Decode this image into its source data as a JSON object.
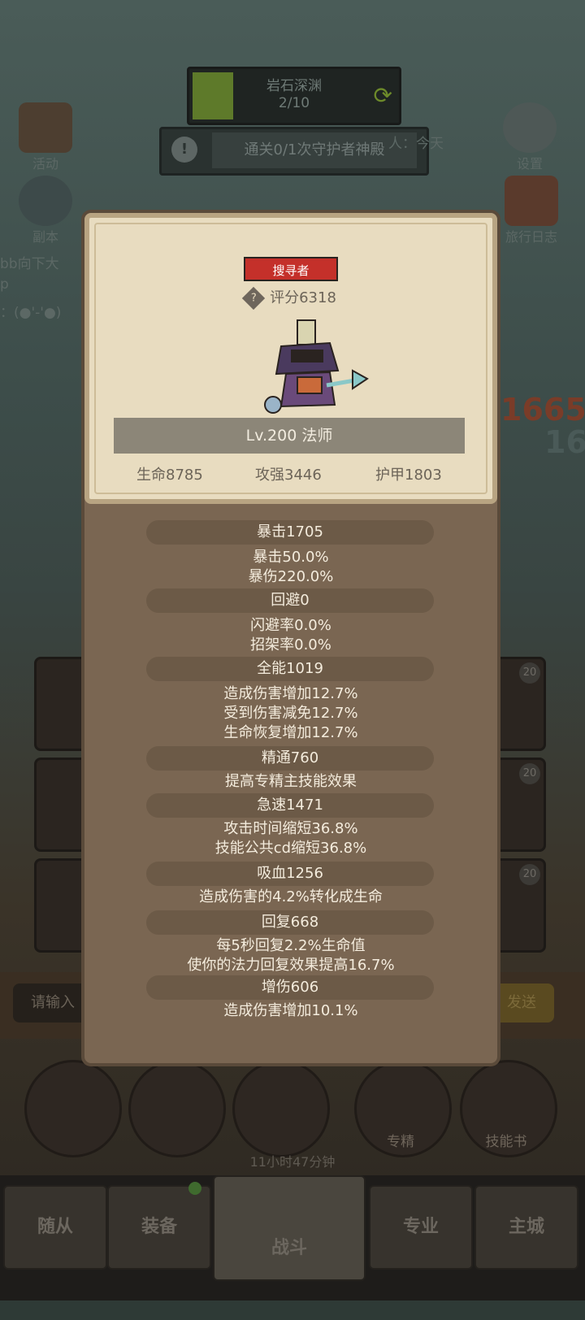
{
  "background": {
    "stage": {
      "name": "岩石深渊",
      "progress": "2/10"
    },
    "quest": {
      "text": "通关0/1次守护者神殿",
      "suffix": "人：今天"
    },
    "side_buttons": {
      "activity": "活动",
      "dungeon": "副本",
      "settings": "设置",
      "journal": "旅行日志"
    },
    "chat_fragments": [
      "bb向下大",
      "p",
      "：(●'-'●)"
    ],
    "damage_numbers": [
      "1665",
      "16"
    ],
    "slot_levels": [
      "20",
      "20",
      "20"
    ],
    "chat": {
      "input_placeholder": "请输入",
      "send_label": "发送"
    },
    "round_buttons": {
      "mastery": "专精",
      "skill_book": "技能书"
    },
    "timer": "11小时47分钟",
    "nav": {
      "followers": "随从",
      "equipment": "装备",
      "battle": "战斗",
      "profession": "专业",
      "main_city": "主城"
    }
  },
  "popup": {
    "title": "搜寻者",
    "score": "评分6318",
    "level_class": "Lv.200 法师",
    "main_stats": {
      "hp": "生命8785",
      "attack": "攻强3446",
      "armor": "护甲1803"
    },
    "stat_groups": [
      {
        "header": "暴击1705",
        "lines": [
          "暴击50.0%",
          "暴伤220.0%"
        ]
      },
      {
        "header": "回避0",
        "lines": [
          "闪避率0.0%",
          "招架率0.0%"
        ]
      },
      {
        "header": "全能1019",
        "lines": [
          "造成伤害增加12.7%",
          "受到伤害减免12.7%",
          "生命恢复增加12.7%"
        ]
      },
      {
        "header": "精通760",
        "lines": [
          "提高专精主技能效果"
        ]
      },
      {
        "header": "急速1471",
        "lines": [
          "攻击时间缩短36.8%",
          "技能公共cd缩短36.8%"
        ]
      },
      {
        "header": "吸血1256",
        "lines": [
          "造成伤害的4.2%转化成生命"
        ]
      },
      {
        "header": "回复668",
        "lines": [
          "每5秒回复2.2%生命值",
          "使你的法力回复效果提高16.7%"
        ]
      },
      {
        "header": "增伤606",
        "lines": [
          "造成伤害增加10.1%"
        ]
      }
    ]
  }
}
